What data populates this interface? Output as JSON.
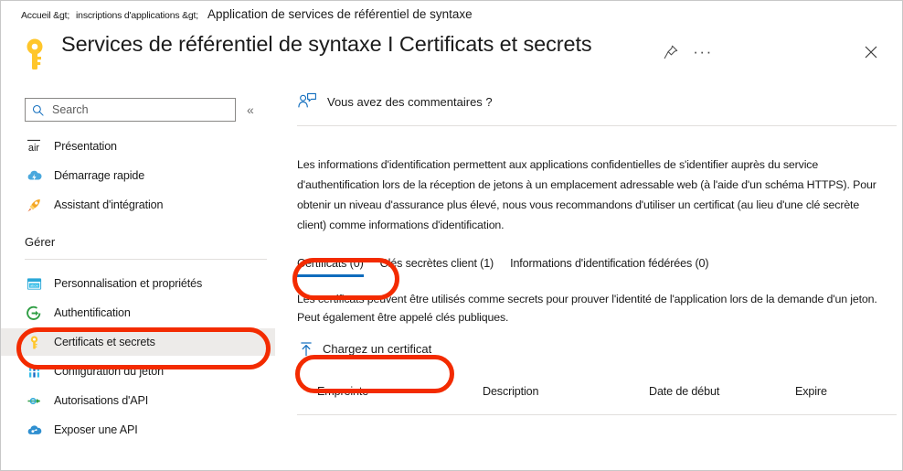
{
  "breadcrumb": {
    "home": "Accueil &gt;",
    "section": "inscriptions d'applications &gt;",
    "current": "Application de services de référentiel de syntaxe"
  },
  "header": {
    "title": "Services de référentiel de syntaxe I Certificats et secrets",
    "key_icon": "key-icon",
    "pin_icon": "pin-icon",
    "more_label": "···",
    "close_icon": "close-icon"
  },
  "sidebar": {
    "search": {
      "placeholder": "Search",
      "value": "",
      "icon": "search-icon"
    },
    "collapse_label": "«",
    "section_label": "Gérer",
    "items": [
      {
        "label": "Présentation",
        "icon": "overview-icon",
        "selected": false
      },
      {
        "label": "Démarrage rapide",
        "icon": "cloud-lightning-icon",
        "selected": false
      },
      {
        "label": "Assistant d'intégration",
        "icon": "rocket-icon",
        "selected": false
      },
      {
        "label": "Personnalisation et propriétés",
        "icon": "branding-window-icon",
        "selected": false
      },
      {
        "label": "Authentification",
        "icon": "arrow-in-circle-icon",
        "selected": false
      },
      {
        "label": "Certificats et secrets",
        "icon": "key-icon",
        "selected": true
      },
      {
        "label": "Configuration du jeton",
        "icon": "token-bars-icon",
        "selected": false
      },
      {
        "label": "Autorisations d'API",
        "icon": "api-arrow-icon",
        "selected": false
      },
      {
        "label": "Exposer une API",
        "icon": "cloud-api-icon",
        "selected": false
      }
    ]
  },
  "main": {
    "feedback": {
      "label": "Vous avez des commentaires ?",
      "icon": "feedback-person-icon"
    },
    "intro": "Les informations d'identification permettent aux applications confidentielles de s'identifier auprès du service d'authentification lors de la réception de jetons à un emplacement adressable web (à l'aide d'un schéma HTTPS). Pour obtenir un niveau d'assurance plus élevé, nous vous recommandons d'utiliser un certificat (au lieu d'une clé secrète client) comme informations d'identification.",
    "tabs": [
      {
        "label": "Certificats (0)",
        "active": true
      },
      {
        "label": "Clés secrètes client (1)",
        "active": false
      },
      {
        "label": "Informations d'identification fédérées (0)",
        "active": false
      }
    ],
    "tab_description": "Les certificats peuvent être utilisés comme secrets pour prouver l'identité de l'application lors de la demande d'un jeton. Peut également être appelé clés publiques.",
    "upload": {
      "label": "Chargez un certificat",
      "icon": "upload-arrow-icon"
    },
    "table": {
      "columns": [
        "Empreinte",
        "Description",
        "Date de début",
        "Expire"
      ],
      "rows": []
    }
  },
  "annotations": {
    "color": "#f32b00",
    "targets": [
      "sidebar-item-certificats-et-secrets",
      "tab-certificats",
      "upload-certificate-button"
    ]
  },
  "colors": {
    "accent_blue": "#0f6cbd",
    "selection_gray": "#edebe9",
    "divider": "#e1dfdd",
    "key_yellow": "#ffc62b",
    "annotation_red": "#f32b00"
  }
}
